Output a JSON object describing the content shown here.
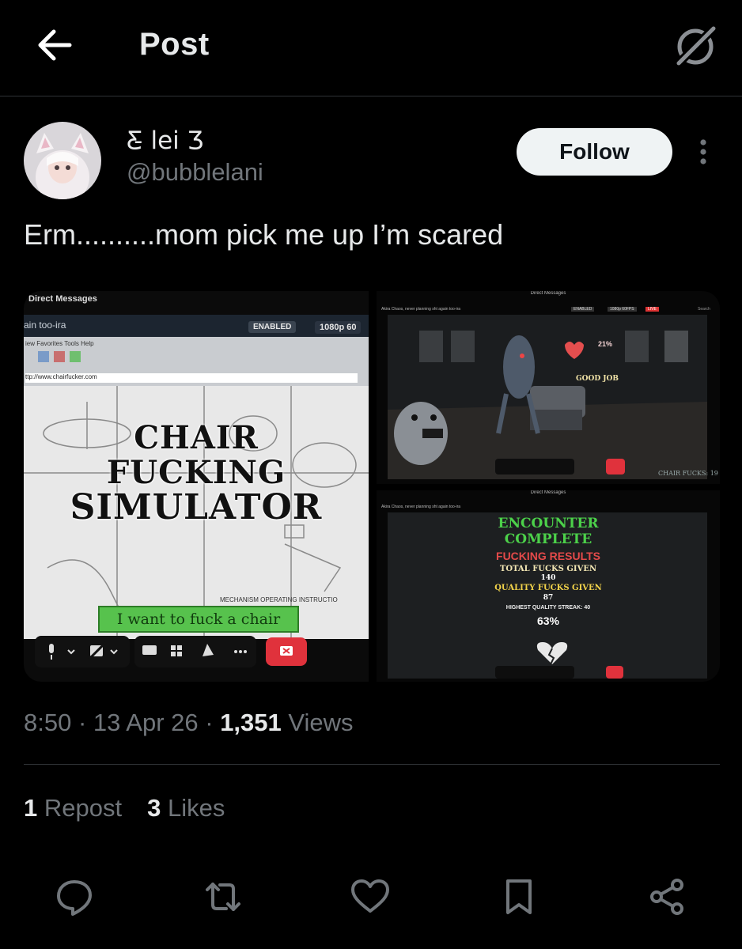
{
  "header": {
    "title": "Post",
    "back_icon": "arrow-left-icon",
    "grok_icon": "grok-icon"
  },
  "author": {
    "display_name": "Ƹ̵ lei Ʒ",
    "handle": "@bubblelani",
    "follow_label": "Follow"
  },
  "post": {
    "text": "Erm..........mom pick me up I’m scared"
  },
  "media": {
    "left": {
      "window_title": "Direct Messages",
      "tab_title": "ain too-ira",
      "enabled_badge": "ENABLED",
      "quality_badge": "1080p 60",
      "menu": "iew  Favorites  Tools  Help",
      "url": "ttp://www.chairfucker.com",
      "game_title_lines": [
        "CHAIR",
        "FUCKING",
        "SIMULATOR"
      ],
      "button_label": "I want to fuck a chair",
      "diagram_caption": "MECHANISM OPERATING INSTRUCTIO"
    },
    "right_top": {
      "window_title": "Direct Messages",
      "channel": "Akira Chaos, never planning sht again too-ira",
      "enabled_badge": "ENABLED",
      "quality_badge": "1080p 60FPS",
      "live_badge": "LIVE",
      "search_placeholder": "Search",
      "heart_percent": "21%",
      "good_job": "GOOD JOB",
      "counter": "CHAIR FUCKS: 19"
    },
    "right_bottom": {
      "window_title": "Direct Messages",
      "channel": "Akira Chaos, never planning sht again too-ira",
      "heading1": "ENCOUNTER",
      "heading2": "COMPLETE",
      "heading3": "FUCKING RESULTS",
      "line1_label": "TOTAL FUCKS GIVEN",
      "line1_value": "140",
      "line2_label": "QUALITY FUCKS GIVEN",
      "line2_value": "87",
      "line3": "HIGHEST QUALITY STREAK: 40",
      "percent": "63%"
    }
  },
  "meta": {
    "time": "8:50",
    "sep1": " · ",
    "date": "13 Apr 26",
    "sep2": " · ",
    "views_count": "1,351",
    "views_label": " Views"
  },
  "stats": {
    "reposts_count": "1",
    "reposts_label": " Repost",
    "likes_count": "3",
    "likes_label": " Likes"
  },
  "actions": [
    "reply-icon",
    "repost-icon",
    "like-icon",
    "bookmark-icon",
    "share-icon"
  ]
}
